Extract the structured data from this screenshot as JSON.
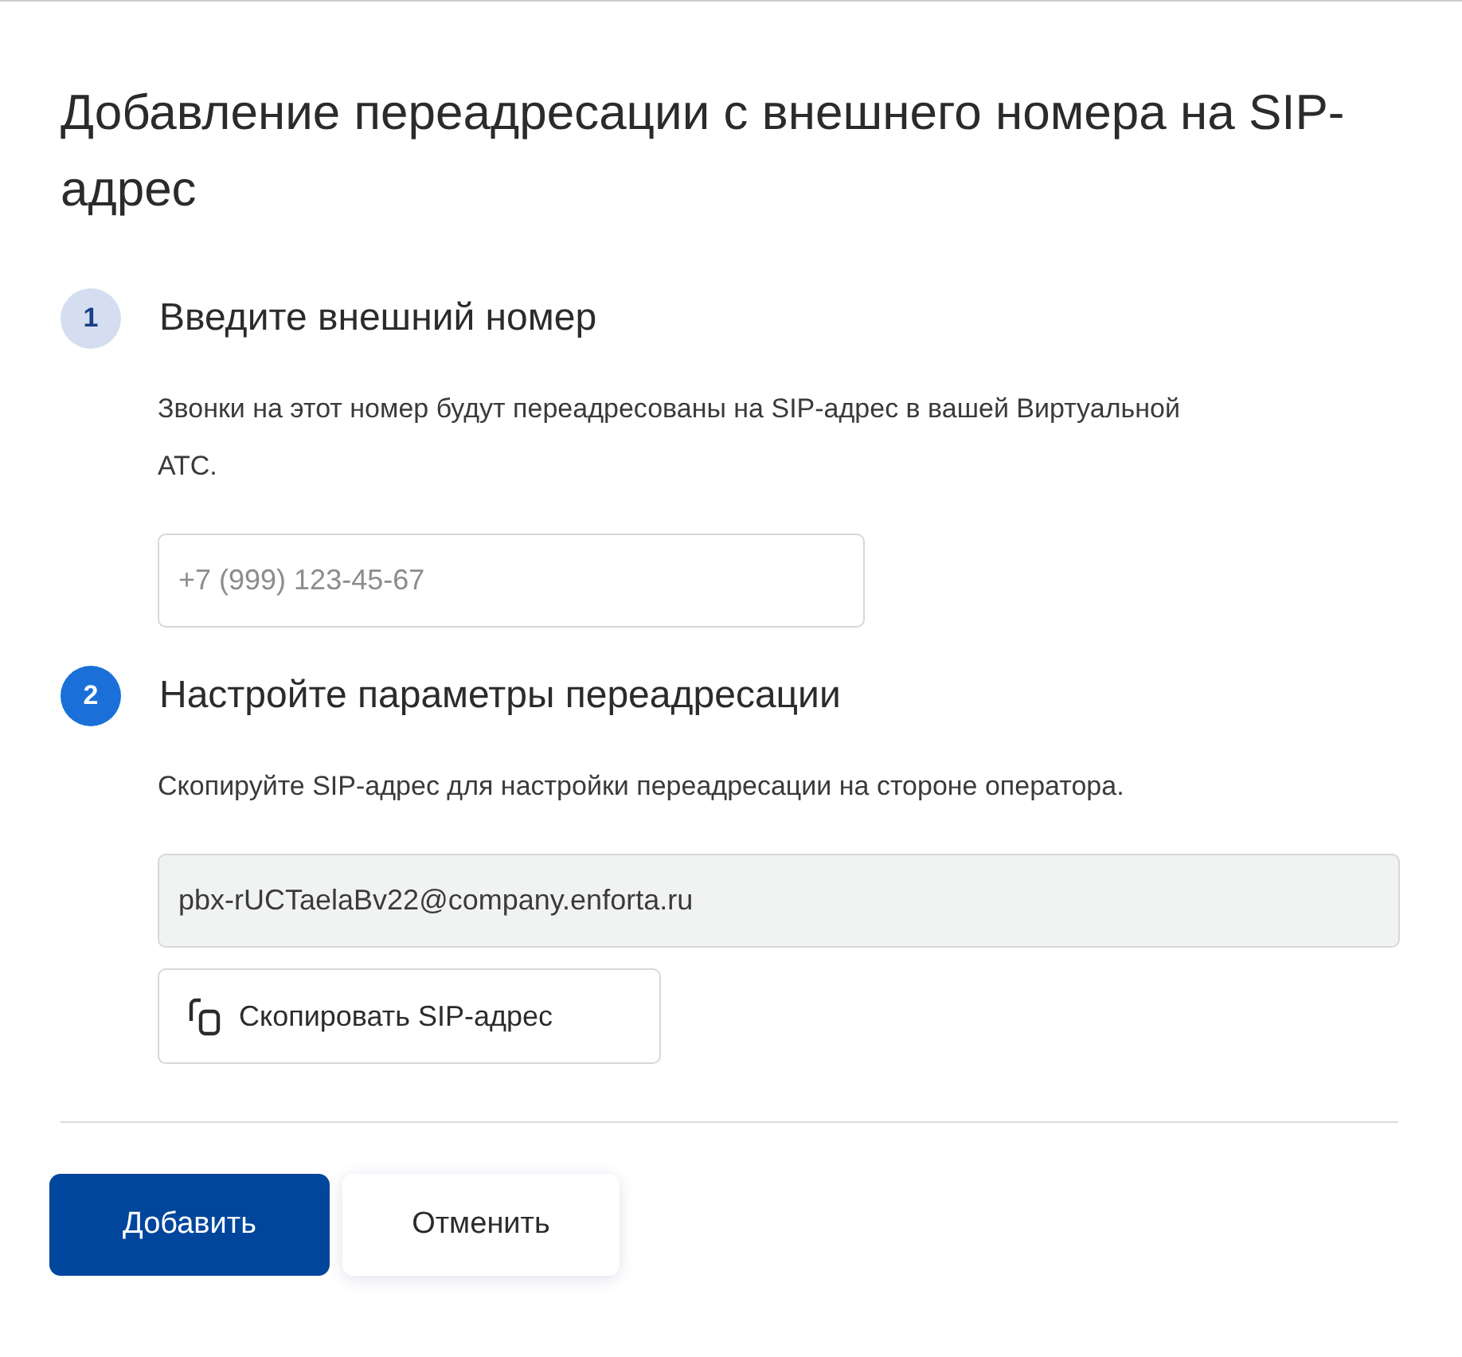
{
  "title": "Добавление переадресации с внешнего номера на SIP-адрес",
  "steps": [
    {
      "number": "1",
      "active": false,
      "heading": "Введите внешний номер",
      "description": "Звонки на этот номер будут переадресованы на SIP-адрес в вашей Виртуальной АТС.",
      "field": {
        "kind": "input",
        "placeholder": "+7 (999) 123-45-67"
      }
    },
    {
      "number": "2",
      "active": true,
      "heading": "Настройте параметры переадресации",
      "description": "Скопируйте SIP-адрес для настройки переадресации на стороне оператора.",
      "field": {
        "kind": "readonly",
        "value": "pbx-rUCTaelaBv22@company.enforta.ru"
      },
      "copy_button": "Скопировать SIP-адрес"
    }
  ],
  "buttons": [
    {
      "label": "Добавить",
      "kind": "primary"
    },
    {
      "label": "Отменить",
      "kind": "secondary"
    }
  ]
}
